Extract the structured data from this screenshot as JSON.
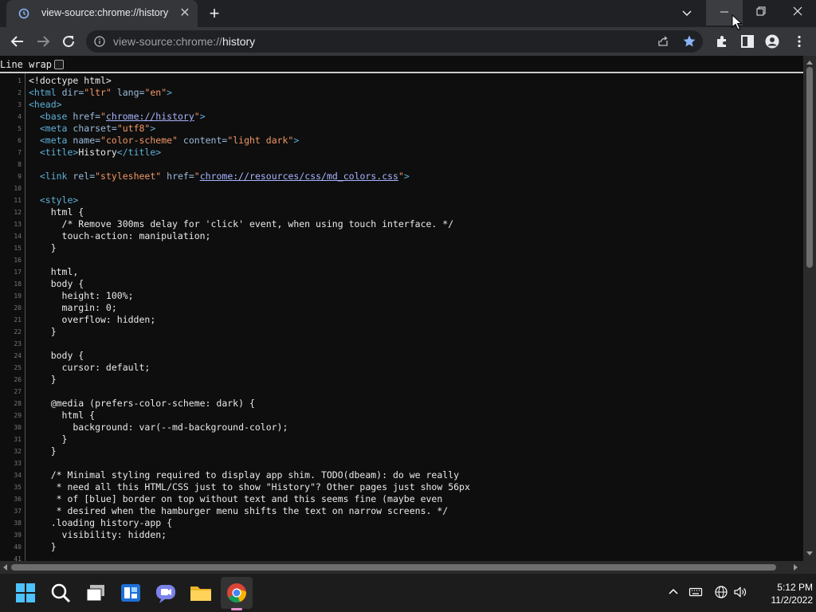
{
  "tab": {
    "title": "view-source:chrome://history",
    "close_icon": "close-icon",
    "favicon": "history-icon"
  },
  "window_controls": {
    "minimize": "minimize-icon",
    "maximize": "restore-icon",
    "close": "close-icon"
  },
  "omnibox": {
    "url_prefix": "view-source:chrome://",
    "url_suffix": "history"
  },
  "page": {
    "line_wrap_label": "Line wrap",
    "line_wrap_checked": false
  },
  "code": [
    {
      "n": "1",
      "h": "&lt;!doctype html&gt;"
    },
    {
      "n": "2",
      "h": "<span class='tag'>&lt;html</span> <span class='attr'>dir=</span><span class='val'>\"ltr\"</span> <span class='attr'>lang=</span><span class='val'>\"en\"</span><span class='tag'>&gt;</span>"
    },
    {
      "n": "3",
      "h": "<span class='tag'>&lt;head&gt;</span>"
    },
    {
      "n": "4",
      "h": "  <span class='tag'>&lt;base</span> <span class='attr'>href=</span><span class='val'>\"</span><span class='lnk'>chrome://history</span><span class='val'>\"</span><span class='tag'>&gt;</span>"
    },
    {
      "n": "5",
      "h": "  <span class='tag'>&lt;meta</span> <span class='attr'>charset=</span><span class='val'>\"utf8\"</span><span class='tag'>&gt;</span>"
    },
    {
      "n": "6",
      "h": "  <span class='tag'>&lt;meta</span> <span class='attr'>name=</span><span class='val'>\"color-scheme\"</span> <span class='attr'>content=</span><span class='val'>\"light dark\"</span><span class='tag'>&gt;</span>"
    },
    {
      "n": "7",
      "h": "  <span class='tag'>&lt;title&gt;</span>History<span class='tag'>&lt;/title&gt;</span>"
    },
    {
      "n": "8",
      "h": ""
    },
    {
      "n": "9",
      "h": "  <span class='tag'>&lt;link</span> <span class='attr'>rel=</span><span class='val'>\"stylesheet\"</span> <span class='attr'>href=</span><span class='val'>\"</span><span class='lnk'>chrome://resources/css/md_colors.css</span><span class='val'>\"</span><span class='tag'>&gt;</span>"
    },
    {
      "n": "10",
      "h": ""
    },
    {
      "n": "11",
      "h": "  <span class='tag'>&lt;style&gt;</span>"
    },
    {
      "n": "12",
      "h": "    html {"
    },
    {
      "n": "13",
      "h": "      /* Remove 300ms delay for 'click' event, when using touch interface. */"
    },
    {
      "n": "14",
      "h": "      touch-action: manipulation;"
    },
    {
      "n": "15",
      "h": "    }"
    },
    {
      "n": "16",
      "h": ""
    },
    {
      "n": "17",
      "h": "    html,"
    },
    {
      "n": "18",
      "h": "    body {"
    },
    {
      "n": "19",
      "h": "      height: 100%;"
    },
    {
      "n": "20",
      "h": "      margin: 0;"
    },
    {
      "n": "21",
      "h": "      overflow: hidden;"
    },
    {
      "n": "22",
      "h": "    }"
    },
    {
      "n": "23",
      "h": ""
    },
    {
      "n": "24",
      "h": "    body {"
    },
    {
      "n": "25",
      "h": "      cursor: default;"
    },
    {
      "n": "26",
      "h": "    }"
    },
    {
      "n": "27",
      "h": ""
    },
    {
      "n": "28",
      "h": "    @media (prefers-color-scheme: dark) {"
    },
    {
      "n": "29",
      "h": "      html {"
    },
    {
      "n": "30",
      "h": "        background: var(--md-background-color);"
    },
    {
      "n": "31",
      "h": "      }"
    },
    {
      "n": "32",
      "h": "    }"
    },
    {
      "n": "33",
      "h": ""
    },
    {
      "n": "34",
      "h": "    /* Minimal styling required to display app shim. TODO(dbeam): do we really"
    },
    {
      "n": "35",
      "h": "     * need all this HTML/CSS just to show \"History\"? Other pages just show 56px"
    },
    {
      "n": "36",
      "h": "     * of [blue] border on top without text and this seems fine (maybe even"
    },
    {
      "n": "37",
      "h": "     * desired when the hamburger menu shifts the text on narrow screens. */"
    },
    {
      "n": "38",
      "h": "    .loading history-app {"
    },
    {
      "n": "39",
      "h": "      visibility: hidden;"
    },
    {
      "n": "40",
      "h": "    }"
    },
    {
      "n": "41",
      "h": ""
    }
  ],
  "taskbar": {
    "icons": [
      "windows-start-icon",
      "search-icon",
      "task-view-icon",
      "widgets-icon",
      "chat-icon",
      "file-explorer-icon",
      "chrome-icon"
    ],
    "tray": [
      "chevron-up-icon",
      "keyboard-icon",
      "network-icon",
      "volume-icon"
    ],
    "time": "5:12 PM",
    "date": "11/2/2022"
  },
  "colors": {
    "accent_star": "#8ab4f8",
    "chrome_active_indicator": "#e58fd0"
  }
}
